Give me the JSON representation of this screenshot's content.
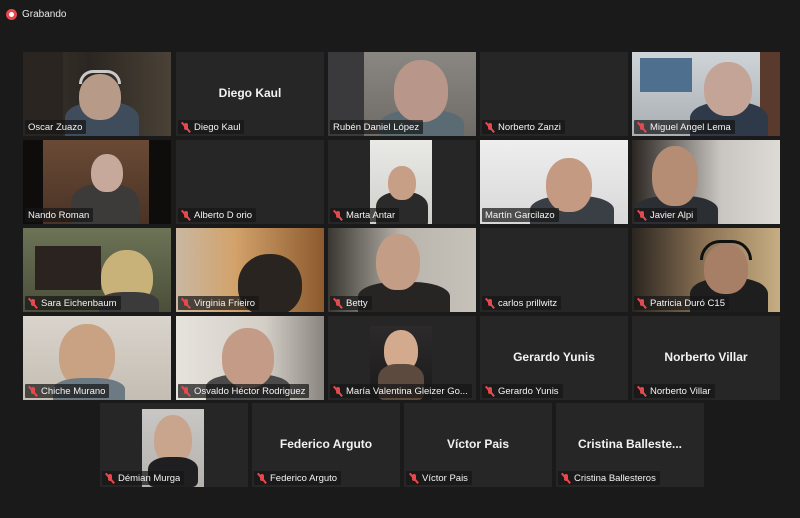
{
  "recording": {
    "label": "Grabando",
    "icon": "recording-dot-icon"
  },
  "colors": {
    "background": "#1a1a1a",
    "tile": "#262626",
    "active_border": "#e6e878",
    "muted": "#e5484d"
  },
  "participants": [
    {
      "name": "Oscar Zuazo",
      "muted": false,
      "video": true,
      "active": true
    },
    {
      "name": "Diego Kaul",
      "muted": true,
      "video": false,
      "center_name": "Diego Kaul"
    },
    {
      "name": "Rubén Daniel López",
      "muted": false,
      "video": true
    },
    {
      "name": "Norberto Zanzi",
      "muted": true,
      "video": false
    },
    {
      "name": "Miguel Angel Lema",
      "muted": true,
      "video": true
    },
    {
      "name": "Nando Roman",
      "muted": false,
      "video": true
    },
    {
      "name": "Alberto D orio",
      "muted": true,
      "video": false
    },
    {
      "name": "Marta Antar",
      "muted": true,
      "video": true
    },
    {
      "name": "Martín Garcilazo",
      "muted": false,
      "video": true
    },
    {
      "name": "Javier Alpi",
      "muted": true,
      "video": true
    },
    {
      "name": "Sara Eichenbaum",
      "muted": true,
      "video": true
    },
    {
      "name": "Virginia Frieiro",
      "muted": true,
      "video": true
    },
    {
      "name": "Betty",
      "muted": true,
      "video": true
    },
    {
      "name": "carlos prillwitz",
      "muted": true,
      "video": false
    },
    {
      "name": "Patricia Duró C15",
      "muted": true,
      "video": true
    },
    {
      "name": "Chiche Murano",
      "muted": true,
      "video": true
    },
    {
      "name": "Osvaldo Héctor Rodriguez",
      "muted": true,
      "video": true
    },
    {
      "name": "María Valentina Gleizer Go...",
      "muted": true,
      "video": true
    },
    {
      "name": "Gerardo Yunis",
      "muted": true,
      "video": false,
      "center_name": "Gerardo Yunis"
    },
    {
      "name": "Norberto Villar",
      "muted": true,
      "video": false,
      "center_name": "Norberto Villar"
    },
    {
      "name": "Démian Murga",
      "muted": true,
      "video": true
    },
    {
      "name": "Federico Arguto",
      "muted": true,
      "video": false,
      "center_name": "Federico Arguto"
    },
    {
      "name": "Víctor Pais",
      "muted": true,
      "video": false,
      "center_name": "Víctor Pais"
    },
    {
      "name": "Cristina Ballesteros",
      "muted": true,
      "video": false,
      "center_name": "Cristina  Balleste..."
    }
  ]
}
